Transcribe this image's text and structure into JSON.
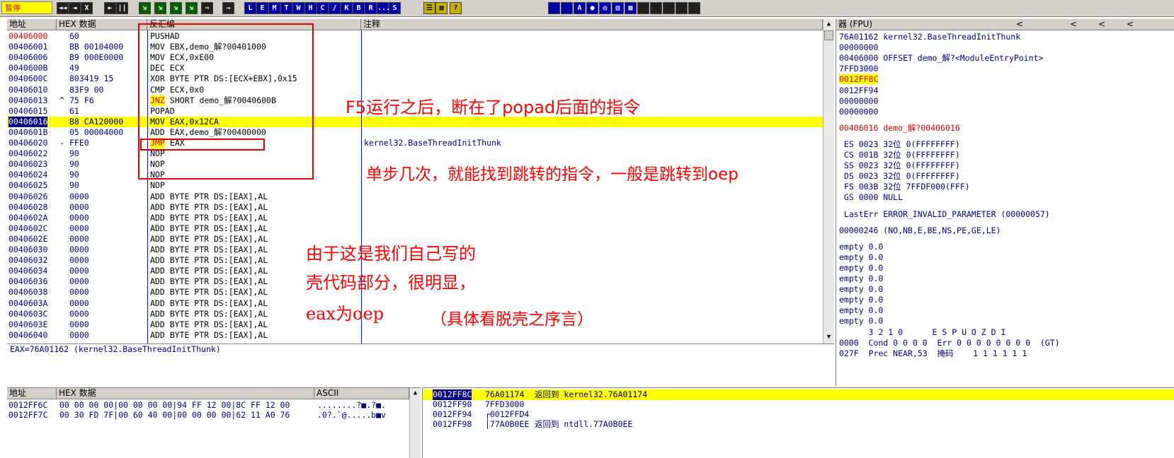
{
  "toolbar": {
    "status": "暂停",
    "buttons": [
      "◄◄",
      "◄",
      "X",
      "►",
      "||",
      "⇲",
      "⇲",
      "⇲",
      "⇲",
      "⇒",
      "→",
      "L",
      "E",
      "M",
      "T",
      "W",
      "H",
      "C",
      "/",
      "K",
      "B",
      "R",
      "...",
      "S",
      "☰",
      "▦",
      "?"
    ],
    "right_buttons": [
      "",
      "",
      "A",
      "●",
      "◎",
      "▥",
      "▦",
      "",
      "",
      "",
      "",
      ""
    ]
  },
  "disasm": {
    "headers": {
      "addr": "地址",
      "hex": "HEX 数据",
      "asm": "反汇编",
      "comment": "注释"
    },
    "rows": [
      {
        "addr": "00406000",
        "mark": "",
        "hex": "60",
        "asm": "PUSHAD",
        "comment": ""
      },
      {
        "addr": "00406001",
        "mark": "",
        "hex": "BB 00104000",
        "asm": "MOV EBX,demo_解?00401000",
        "comment": ""
      },
      {
        "addr": "00406006",
        "mark": "",
        "hex": "B9 000E0000",
        "asm": "MOV ECX,0xE00",
        "comment": ""
      },
      {
        "addr": "0040600B",
        "mark": "",
        "hex": "49",
        "asm": "DEC ECX",
        "comment": ""
      },
      {
        "addr": "0040600C",
        "mark": "",
        "hex": "803419 15",
        "asm": "XOR BYTE PTR DS:[ECX+EBX],0x15",
        "comment": ""
      },
      {
        "addr": "00406010",
        "mark": "",
        "hex": "83F9 00",
        "asm": "CMP ECX,0x0",
        "comment": ""
      },
      {
        "addr": "00406013",
        "mark": "^",
        "hex": "75 F6",
        "asm_op": "JNZ",
        "asm": " SHORT demo_解?0040600B",
        "comment": ""
      },
      {
        "addr": "00406015",
        "mark": "",
        "hex": "61",
        "asm": "POPAD",
        "comment": ""
      },
      {
        "addr": "00406016",
        "mark": "",
        "hex": "B8 CA120000",
        "asm": "MOV EAX,0x12CA",
        "comment": ""
      },
      {
        "addr": "0040601B",
        "mark": "",
        "hex": "05 00004000",
        "asm": "ADD EAX,demo_解?00400000",
        "comment": ""
      },
      {
        "addr": "00406020",
        "mark": "-",
        "hex": "FFE0",
        "asm_op": "JMP",
        "asm": " EAX",
        "comment": "kernel32.BaseThreadInitThunk"
      },
      {
        "addr": "00406022",
        "mark": "",
        "hex": "90",
        "asm": "NOP",
        "comment": ""
      },
      {
        "addr": "00406023",
        "mark": "",
        "hex": "90",
        "asm": "NOP",
        "comment": ""
      },
      {
        "addr": "00406024",
        "mark": "",
        "hex": "90",
        "asm": "NOP",
        "comment": ""
      },
      {
        "addr": "00406025",
        "mark": "",
        "hex": "90",
        "asm": "NOP",
        "comment": ""
      },
      {
        "addr": "00406026",
        "mark": "",
        "hex": "0000",
        "asm": "ADD BYTE PTR DS:[EAX],AL",
        "comment": ""
      },
      {
        "addr": "00406028",
        "mark": "",
        "hex": "0000",
        "asm": "ADD BYTE PTR DS:[EAX],AL",
        "comment": ""
      },
      {
        "addr": "0040602A",
        "mark": "",
        "hex": "0000",
        "asm": "ADD BYTE PTR DS:[EAX],AL",
        "comment": ""
      },
      {
        "addr": "0040602C",
        "mark": "",
        "hex": "0000",
        "asm": "ADD BYTE PTR DS:[EAX],AL",
        "comment": ""
      },
      {
        "addr": "0040602E",
        "mark": "",
        "hex": "0000",
        "asm": "ADD BYTE PTR DS:[EAX],AL",
        "comment": ""
      },
      {
        "addr": "00406030",
        "mark": "",
        "hex": "0000",
        "asm": "ADD BYTE PTR DS:[EAX],AL",
        "comment": ""
      },
      {
        "addr": "00406032",
        "mark": "",
        "hex": "0000",
        "asm": "ADD BYTE PTR DS:[EAX],AL",
        "comment": ""
      },
      {
        "addr": "00406034",
        "mark": "",
        "hex": "0000",
        "asm": "ADD BYTE PTR DS:[EAX],AL",
        "comment": ""
      },
      {
        "addr": "00406036",
        "mark": "",
        "hex": "0000",
        "asm": "ADD BYTE PTR DS:[EAX],AL",
        "comment": ""
      },
      {
        "addr": "00406038",
        "mark": "",
        "hex": "0000",
        "asm": "ADD BYTE PTR DS:[EAX],AL",
        "comment": ""
      },
      {
        "addr": "0040603A",
        "mark": "",
        "hex": "0000",
        "asm": "ADD BYTE PTR DS:[EAX],AL",
        "comment": ""
      },
      {
        "addr": "0040603C",
        "mark": "",
        "hex": "0000",
        "asm": "ADD BYTE PTR DS:[EAX],AL",
        "comment": ""
      },
      {
        "addr": "0040603E",
        "mark": "",
        "hex": "0000",
        "asm": "ADD BYTE PTR DS:[EAX],AL",
        "comment": ""
      },
      {
        "addr": "00406040",
        "mark": "",
        "hex": "0000",
        "asm": "ADD BYTE PTR DS:[EAX],AL",
        "comment": ""
      }
    ],
    "info_line": "EAX=76A01162 (kernel32.BaseThreadInitThunk)"
  },
  "annotations": {
    "note1": "F5运行之后，断在了popad后面的指令",
    "note2": "单步几次，就能找到跳转的指令，一般是跳转到oep",
    "note3_lines": [
      "由于这是我们自己写的",
      "壳代码部分，很明显，",
      "eax为oep"
    ],
    "note4": "（具体看脱壳之序言）"
  },
  "registers": {
    "header": "器 (FPU)",
    "nav": [
      "<",
      "<",
      "<",
      "<"
    ],
    "lines": [
      "76A01162 kernel32.BaseThreadInitThunk",
      "00000000",
      "00406000 OFFSET demo_解?<ModuleEntryPoint>",
      "7FFD3000",
      "0012FF8C",
      "0012FF94",
      "00000000",
      "00000000",
      "",
      "00406016 demo_解?00406016",
      "",
      " ES 0023 32位 0(FFFFFFFF)",
      " CS 001B 32位 0(FFFFFFFF)",
      " SS 0023 32位 0(FFFFFFFF)",
      " DS 0023 32位 0(FFFFFFFF)",
      " FS 003B 32位 7FFDF000(FFF)",
      " GS 0000 NULL",
      "",
      " LastErr ERROR_INVALID_PARAMETER (00000057)",
      "",
      "00000246 (NO,NB,E,BE,NS,PE,GE,LE)",
      "",
      "empty 0.0",
      "empty 0.0",
      "empty 0.0",
      "empty 0.0",
      "empty 0.0",
      "empty 0.0",
      "empty 0.0",
      "empty 0.0",
      "      3 2 1 0      E S P U O Z D I",
      "0000  Cond 0 0 0 0  Err 0 0 0 0 0 0 0 0  (GT)",
      "027F  Prec NEAR,53  掩码    1 1 1 1 1 1"
    ]
  },
  "dump": {
    "headers": {
      "addr": "地址",
      "hex": "HEX 数据",
      "ascii": "ASCII"
    },
    "rows": [
      {
        "addr": "0012FF6C",
        "hex": "00 00 00 00|00 00 00 00|94 FF 12 00|8C FF 12 00",
        "ascii": "........?■.?■."
      },
      {
        "addr": "0012FF7C",
        "hex": "00 30 FD 7F|00 60 40 00|00 00 00 00|62 11 A0 76",
        "ascii": ".0?.`@.....b■v"
      }
    ]
  },
  "stack": {
    "rows": [
      {
        "addr": "0012FF8C",
        "value": "76A01174",
        "comment": "返回到 kernel32.76A01174"
      },
      {
        "addr": "0012FF90",
        "value": "7FFD3000",
        "comment": ""
      },
      {
        "addr": "0012FF94",
        "value": "┌0012FFD4",
        "comment": ""
      },
      {
        "addr": "0012FF98",
        "value": "│77A0B0EE",
        "comment": "返回到 ntdll.77A0B0EE"
      }
    ]
  }
}
